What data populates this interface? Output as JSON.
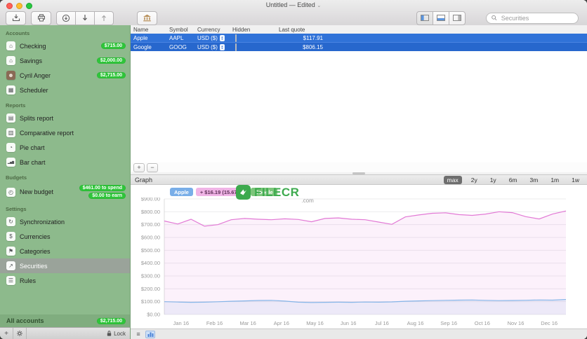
{
  "titlebar": {
    "title": "Untitled — Edited"
  },
  "toolbar": {
    "left_icons": [
      "import-icon",
      "print-icon",
      "refresh-quotes-icon",
      "move-down-icon",
      "move-up-icon",
      "bank-icon"
    ],
    "view_buttons": [
      "view-left-pane-icon",
      "view-bottom-pane-icon",
      "view-right-pane-icon"
    ],
    "search": {
      "placeholder": "Securities"
    }
  },
  "sidebar": {
    "sections": [
      {
        "label": "Accounts",
        "items": [
          {
            "label": "Checking",
            "icon": "bank",
            "badge": "$715.00"
          },
          {
            "label": "Savings",
            "icon": "bank",
            "badge": "$2,000.00"
          },
          {
            "label": "Cyril Anger",
            "icon": "person",
            "badge": "$2,715.00"
          },
          {
            "label": "Scheduler",
            "icon": "calendar"
          }
        ]
      },
      {
        "label": "Reports",
        "items": [
          {
            "label": "Splits report",
            "icon": "doc"
          },
          {
            "label": "Comparative report",
            "icon": "doc2"
          },
          {
            "label": "Pie chart",
            "icon": "pie"
          },
          {
            "label": "Bar chart",
            "icon": "bars"
          }
        ]
      },
      {
        "label": "Budgets",
        "items": [
          {
            "label": "New budget",
            "icon": "gauge",
            "badges": [
              "$461.00 to spend",
              "$0.00 to earn"
            ]
          }
        ]
      },
      {
        "label": "Settings",
        "items": [
          {
            "label": "Synchronization",
            "icon": "sync"
          },
          {
            "label": "Currencies",
            "icon": "coins"
          },
          {
            "label": "Categories",
            "icon": "tags"
          },
          {
            "label": "Securities",
            "icon": "chart",
            "selected": true
          },
          {
            "label": "Rules",
            "icon": "rules"
          }
        ]
      }
    ],
    "footer": {
      "label": "All accounts",
      "badge": "$2,715.00"
    },
    "bottom_bar": {
      "add_label": "+",
      "lock_label": "Lock"
    }
  },
  "table": {
    "columns": [
      "Name",
      "Symbol",
      "Currency",
      "Hidden",
      "Last quote"
    ],
    "add_label": "+",
    "remove_label": "−",
    "rows": [
      {
        "name": "Apple",
        "symbol": "AAPL",
        "currency": "USD ($)",
        "hidden": false,
        "last_quote": "$117.91",
        "selected": true
      },
      {
        "name": "Google",
        "symbol": "GOOG",
        "currency": "USD ($)",
        "hidden": false,
        "last_quote": "$806.15",
        "selected": true
      }
    ]
  },
  "graph": {
    "title": "Graph",
    "ranges": [
      "max",
      "2y",
      "1y",
      "6m",
      "3m",
      "1m",
      "1w"
    ],
    "selected_range": "max",
    "legend": [
      {
        "name": "Apple",
        "name_color": "#79aee8",
        "change": "+ $16.19 (15.67%)",
        "change_color": "#f0b4e6"
      },
      {
        "name": "Google",
        "name_color": "#7cc57a",
        "change": "",
        "change_color": ""
      }
    ]
  },
  "chart_data": {
    "type": "line",
    "title": "Graph",
    "x_labels": [
      "Jan 16",
      "Feb 16",
      "Mar 16",
      "Apr 16",
      "May 16",
      "Jun 16",
      "Jul 16",
      "Aug 16",
      "Sep 16",
      "Oct 16",
      "Nov 16",
      "Dec 16"
    ],
    "ylim": [
      0,
      900
    ],
    "ytick_step": 100,
    "grid": true,
    "legend_position": "top-left",
    "series": [
      {
        "name": "Google",
        "color": "#e279d5",
        "fill": "rgba(226,121,213,0.10)",
        "values": [
          728,
          705,
          742,
          688,
          700,
          738,
          748,
          742,
          738,
          745,
          740,
          722,
          748,
          752,
          742,
          738,
          720,
          702,
          760,
          775,
          788,
          792,
          778,
          772,
          782,
          800,
          793,
          762,
          744,
          782,
          806
        ]
      },
      {
        "name": "Apple",
        "color": "#85b5e8",
        "fill": "rgba(133,181,232,0.12)",
        "values": [
          100,
          97,
          95,
          96,
          99,
          103,
          106,
          109,
          110,
          104,
          96,
          93,
          95,
          96,
          95,
          97,
          96,
          98,
          103,
          106,
          108,
          110,
          112,
          113,
          110,
          108,
          109,
          111,
          113,
          112,
          117
        ]
      }
    ]
  },
  "watermark": {
    "text": "FILECR",
    "suffix": ".com"
  }
}
